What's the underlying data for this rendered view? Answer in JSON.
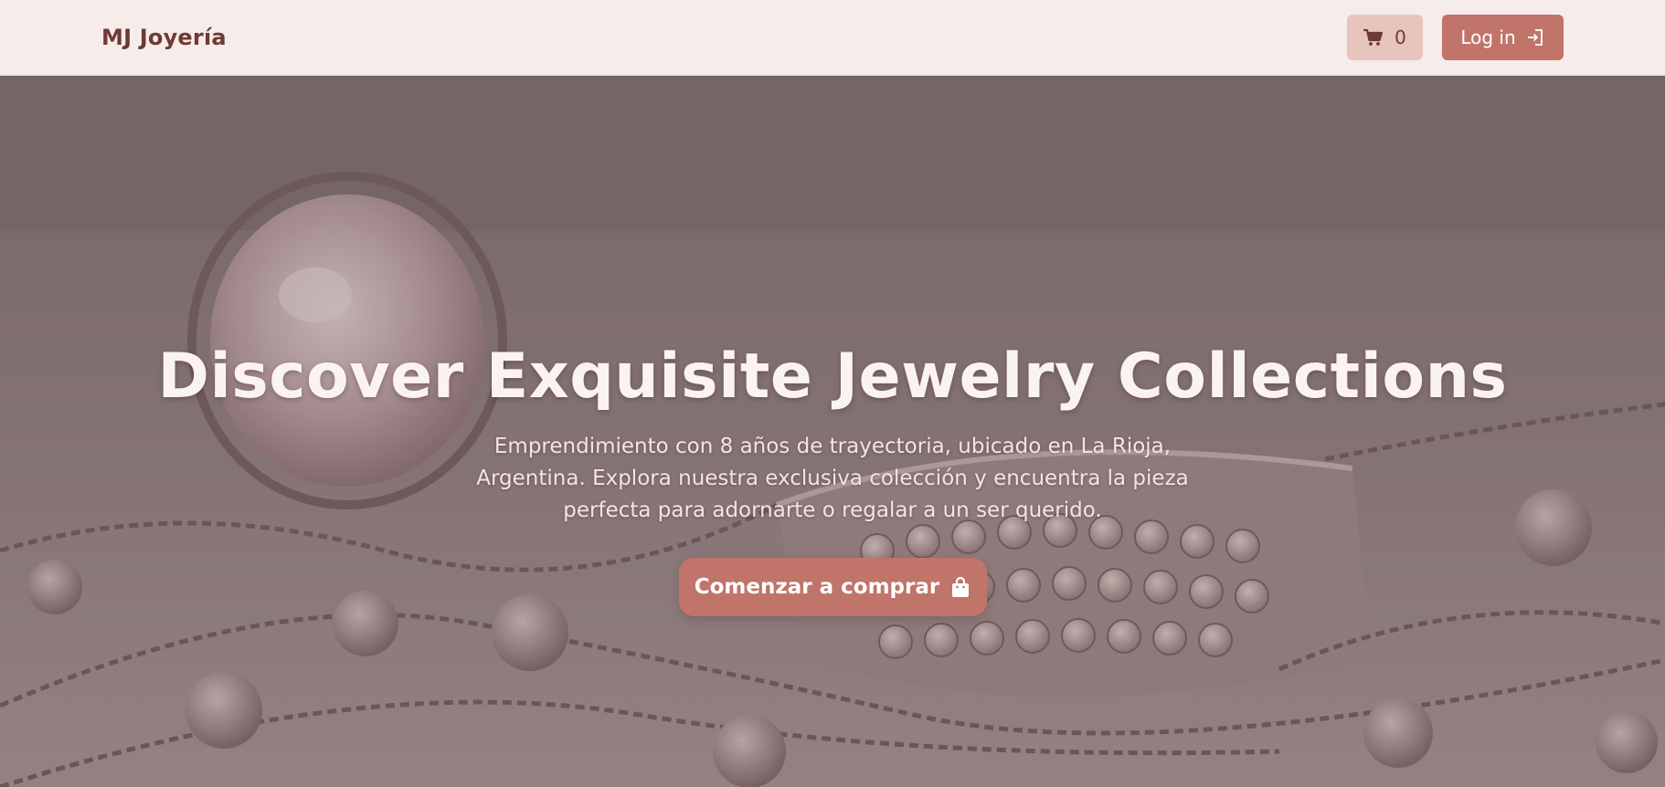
{
  "navbar": {
    "brand": "MJ Joyería",
    "cart_count": "0",
    "cart_icon": "cart-icon",
    "login_label": "Log in",
    "login_icon": "login-icon"
  },
  "hero": {
    "title": "Discover Exquisite Jewelry Collections",
    "subtitle": "Emprendimiento con 8 años de trayectoria, ubicado en La Rioja, Argentina. Explora nuestra exclusiva colección y encuentra la pieza perfecta para adornarte o regalar a un ser querido.",
    "cta_label": "Comenzar a comprar",
    "cta_icon": "shopping-bag-icon"
  },
  "colors": {
    "brand_text": "#6e3a31",
    "nav_bg": "#f6ecea",
    "accent": "#c0746a",
    "cart_bg": "#e8c4be"
  }
}
